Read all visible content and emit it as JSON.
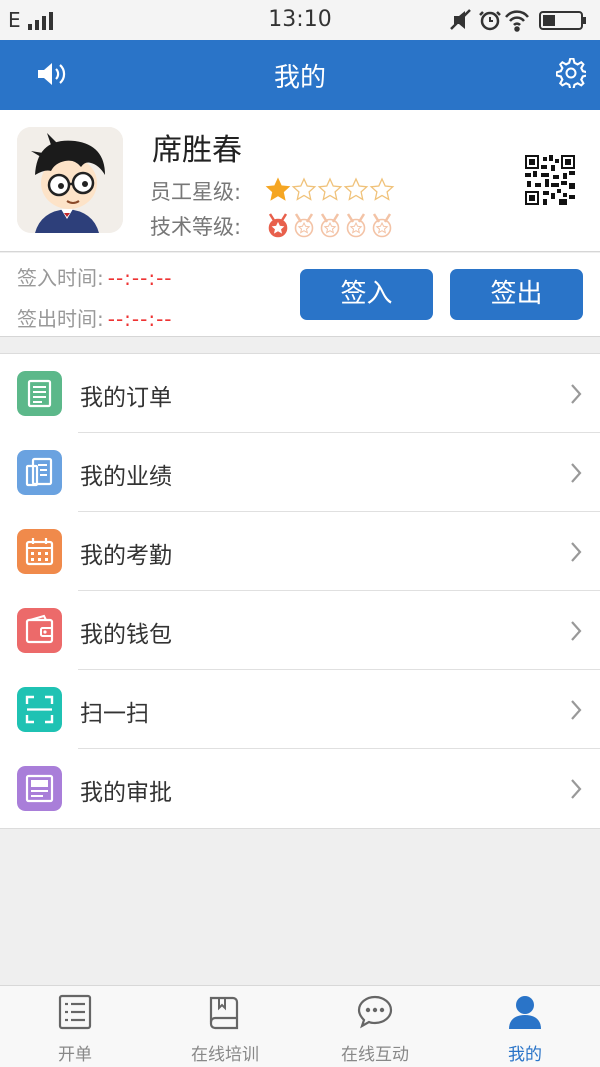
{
  "status_bar": {
    "network": "E",
    "time": "13:10"
  },
  "header": {
    "title": "我的"
  },
  "profile": {
    "name": "席胜春",
    "star_label": "员工星级:",
    "star_rating": 1,
    "star_max": 5,
    "tech_label": "技术等级:",
    "tech_level": 1,
    "tech_max": 5
  },
  "checkin": {
    "in_label": "签入时间:",
    "in_value": "--:--:--",
    "out_label": "签出时间:",
    "out_value": "--:--:--",
    "in_button": "签入",
    "out_button": "签出"
  },
  "menu": {
    "items": [
      {
        "label": "我的订单",
        "icon": "order-list-icon",
        "color": "#5cb88a"
      },
      {
        "label": "我的业绩",
        "icon": "performance-icon",
        "color": "#6aa2e0"
      },
      {
        "label": "我的考勤",
        "icon": "calendar-icon",
        "color": "#f08a4b"
      },
      {
        "label": "我的钱包",
        "icon": "wallet-icon",
        "color": "#ec6a6a"
      },
      {
        "label": "扫一扫",
        "icon": "scan-icon",
        "color": "#1fc2b3"
      },
      {
        "label": "我的审批",
        "icon": "approval-icon",
        "color": "#a97ed9"
      }
    ]
  },
  "tabs": [
    {
      "label": "开单",
      "icon": "list-icon"
    },
    {
      "label": "在线培训",
      "icon": "book-icon"
    },
    {
      "label": "在线互动",
      "icon": "chat-icon"
    },
    {
      "label": "我的",
      "icon": "user-icon",
      "active": true
    }
  ],
  "colors": {
    "primary": "#2a74c8",
    "star": "#f5a623",
    "medal": "#e8604c",
    "time_value": "#e33333"
  }
}
